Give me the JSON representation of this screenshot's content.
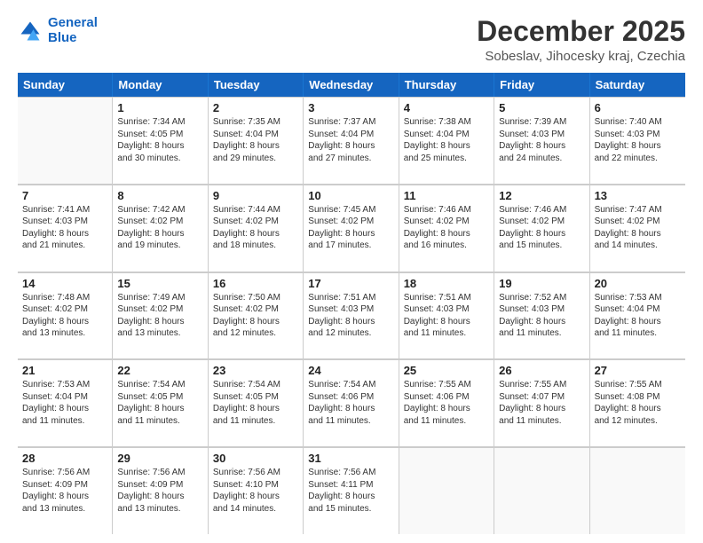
{
  "logo": {
    "line1": "General",
    "line2": "Blue"
  },
  "title": "December 2025",
  "subtitle": "Sobeslav, Jihocesky kraj, Czechia",
  "header_days": [
    "Sunday",
    "Monday",
    "Tuesday",
    "Wednesday",
    "Thursday",
    "Friday",
    "Saturday"
  ],
  "weeks": [
    [
      {
        "day": "",
        "info": ""
      },
      {
        "day": "1",
        "info": "Sunrise: 7:34 AM\nSunset: 4:05 PM\nDaylight: 8 hours\nand 30 minutes."
      },
      {
        "day": "2",
        "info": "Sunrise: 7:35 AM\nSunset: 4:04 PM\nDaylight: 8 hours\nand 29 minutes."
      },
      {
        "day": "3",
        "info": "Sunrise: 7:37 AM\nSunset: 4:04 PM\nDaylight: 8 hours\nand 27 minutes."
      },
      {
        "day": "4",
        "info": "Sunrise: 7:38 AM\nSunset: 4:04 PM\nDaylight: 8 hours\nand 25 minutes."
      },
      {
        "day": "5",
        "info": "Sunrise: 7:39 AM\nSunset: 4:03 PM\nDaylight: 8 hours\nand 24 minutes."
      },
      {
        "day": "6",
        "info": "Sunrise: 7:40 AM\nSunset: 4:03 PM\nDaylight: 8 hours\nand 22 minutes."
      }
    ],
    [
      {
        "day": "7",
        "info": "Sunrise: 7:41 AM\nSunset: 4:03 PM\nDaylight: 8 hours\nand 21 minutes."
      },
      {
        "day": "8",
        "info": "Sunrise: 7:42 AM\nSunset: 4:02 PM\nDaylight: 8 hours\nand 19 minutes."
      },
      {
        "day": "9",
        "info": "Sunrise: 7:44 AM\nSunset: 4:02 PM\nDaylight: 8 hours\nand 18 minutes."
      },
      {
        "day": "10",
        "info": "Sunrise: 7:45 AM\nSunset: 4:02 PM\nDaylight: 8 hours\nand 17 minutes."
      },
      {
        "day": "11",
        "info": "Sunrise: 7:46 AM\nSunset: 4:02 PM\nDaylight: 8 hours\nand 16 minutes."
      },
      {
        "day": "12",
        "info": "Sunrise: 7:46 AM\nSunset: 4:02 PM\nDaylight: 8 hours\nand 15 minutes."
      },
      {
        "day": "13",
        "info": "Sunrise: 7:47 AM\nSunset: 4:02 PM\nDaylight: 8 hours\nand 14 minutes."
      }
    ],
    [
      {
        "day": "14",
        "info": "Sunrise: 7:48 AM\nSunset: 4:02 PM\nDaylight: 8 hours\nand 13 minutes."
      },
      {
        "day": "15",
        "info": "Sunrise: 7:49 AM\nSunset: 4:02 PM\nDaylight: 8 hours\nand 13 minutes."
      },
      {
        "day": "16",
        "info": "Sunrise: 7:50 AM\nSunset: 4:02 PM\nDaylight: 8 hours\nand 12 minutes."
      },
      {
        "day": "17",
        "info": "Sunrise: 7:51 AM\nSunset: 4:03 PM\nDaylight: 8 hours\nand 12 minutes."
      },
      {
        "day": "18",
        "info": "Sunrise: 7:51 AM\nSunset: 4:03 PM\nDaylight: 8 hours\nand 11 minutes."
      },
      {
        "day": "19",
        "info": "Sunrise: 7:52 AM\nSunset: 4:03 PM\nDaylight: 8 hours\nand 11 minutes."
      },
      {
        "day": "20",
        "info": "Sunrise: 7:53 AM\nSunset: 4:04 PM\nDaylight: 8 hours\nand 11 minutes."
      }
    ],
    [
      {
        "day": "21",
        "info": "Sunrise: 7:53 AM\nSunset: 4:04 PM\nDaylight: 8 hours\nand 11 minutes."
      },
      {
        "day": "22",
        "info": "Sunrise: 7:54 AM\nSunset: 4:05 PM\nDaylight: 8 hours\nand 11 minutes."
      },
      {
        "day": "23",
        "info": "Sunrise: 7:54 AM\nSunset: 4:05 PM\nDaylight: 8 hours\nand 11 minutes."
      },
      {
        "day": "24",
        "info": "Sunrise: 7:54 AM\nSunset: 4:06 PM\nDaylight: 8 hours\nand 11 minutes."
      },
      {
        "day": "25",
        "info": "Sunrise: 7:55 AM\nSunset: 4:06 PM\nDaylight: 8 hours\nand 11 minutes."
      },
      {
        "day": "26",
        "info": "Sunrise: 7:55 AM\nSunset: 4:07 PM\nDaylight: 8 hours\nand 11 minutes."
      },
      {
        "day": "27",
        "info": "Sunrise: 7:55 AM\nSunset: 4:08 PM\nDaylight: 8 hours\nand 12 minutes."
      }
    ],
    [
      {
        "day": "28",
        "info": "Sunrise: 7:56 AM\nSunset: 4:09 PM\nDaylight: 8 hours\nand 13 minutes."
      },
      {
        "day": "29",
        "info": "Sunrise: 7:56 AM\nSunset: 4:09 PM\nDaylight: 8 hours\nand 13 minutes."
      },
      {
        "day": "30",
        "info": "Sunrise: 7:56 AM\nSunset: 4:10 PM\nDaylight: 8 hours\nand 14 minutes."
      },
      {
        "day": "31",
        "info": "Sunrise: 7:56 AM\nSunset: 4:11 PM\nDaylight: 8 hours\nand 15 minutes."
      },
      {
        "day": "",
        "info": ""
      },
      {
        "day": "",
        "info": ""
      },
      {
        "day": "",
        "info": ""
      }
    ]
  ]
}
